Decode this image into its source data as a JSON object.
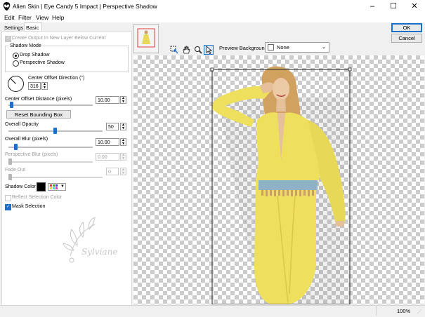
{
  "window": {
    "title": "Alien Skin | Eye Candy 5 Impact | Perspective Shadow",
    "minimize": "–",
    "maximize": "☐",
    "close": "✕"
  },
  "menu": [
    "Edit",
    "Filter",
    "View",
    "Help"
  ],
  "tabs": [
    {
      "label": "Settings",
      "active": false
    },
    {
      "label": "Basic",
      "active": true
    }
  ],
  "basic": {
    "create_output_label": "Create Output In New Layer Below Current",
    "shadow_mode_label": "Shadow Mode",
    "drop_shadow_label": "Drop Shadow",
    "perspective_shadow_label": "Perspective Shadow",
    "selected_mode": "Drop Shadow",
    "center_offset_direction_label": "Center Offset Direction (°)",
    "center_offset_direction_value": "316",
    "center_offset_distance_label": "Center Offset Distance (pixels)",
    "center_offset_distance_value": "10.00",
    "center_offset_distance_level": 0.05,
    "reset_bounding_box_label": "Reset Bounding Box",
    "overall_opacity_label": "Overall Opacity",
    "overall_opacity_value": "50",
    "overall_opacity_level": 0.5,
    "overall_blur_label": "Overall Blur (pixels)",
    "overall_blur_value": "10.00",
    "overall_blur_level": 0.07,
    "perspective_blur_label": "Perspective Blur (pixels)",
    "perspective_blur_value": "0.00",
    "fade_out_label": "Fade Out",
    "fade_out_value": "0",
    "shadow_color_label": "Shadow Color",
    "shadow_color": "#000000",
    "reflect_selection_label": "Reflect Selection Color",
    "mask_selection_label": "Mask Selection",
    "mask_selection_checked": true,
    "watermark_text": "Sylviane"
  },
  "toolbar": {
    "tool_icons": [
      "selection-adjust-icon",
      "hand-icon",
      "zoom-icon",
      "pointer-icon"
    ],
    "preview_background_label": "Preview Background:",
    "preview_background_value": "None"
  },
  "buttons": {
    "ok": "OK",
    "cancel": "Cancel"
  },
  "status": {
    "zoom": "100%"
  },
  "colors": {
    "accent": "#1d6fc9",
    "dress": "#eedf5c",
    "selection_box": "#222222"
  }
}
